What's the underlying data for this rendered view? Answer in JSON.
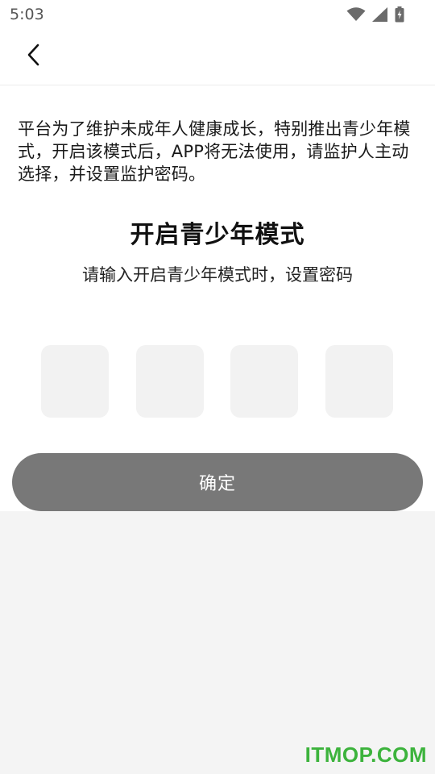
{
  "status_bar": {
    "time": "5:03",
    "icons": [
      "wifi-icon",
      "cell-signal-icon",
      "battery-charging-icon"
    ]
  },
  "nav": {
    "back_icon": "chevron-left-icon"
  },
  "notice": {
    "text": "平台为了维护未成年人健康成长，特别推出青少年模式，开启该模式后，APP将无法使用，请监护人主动选择，并设置监护密码。"
  },
  "title": "开启青少年模式",
  "subtitle": "请输入开启青少年模式时，设置密码",
  "code_inputs": [
    "",
    "",
    "",
    ""
  ],
  "confirm_button": {
    "label": "确定"
  },
  "watermark": "ITMOP.COM",
  "colors": {
    "button_bg": "#787878",
    "code_box_bg": "#f2f2f2",
    "page_bg": "#f4f4f4",
    "watermark": "#3cb33c"
  }
}
